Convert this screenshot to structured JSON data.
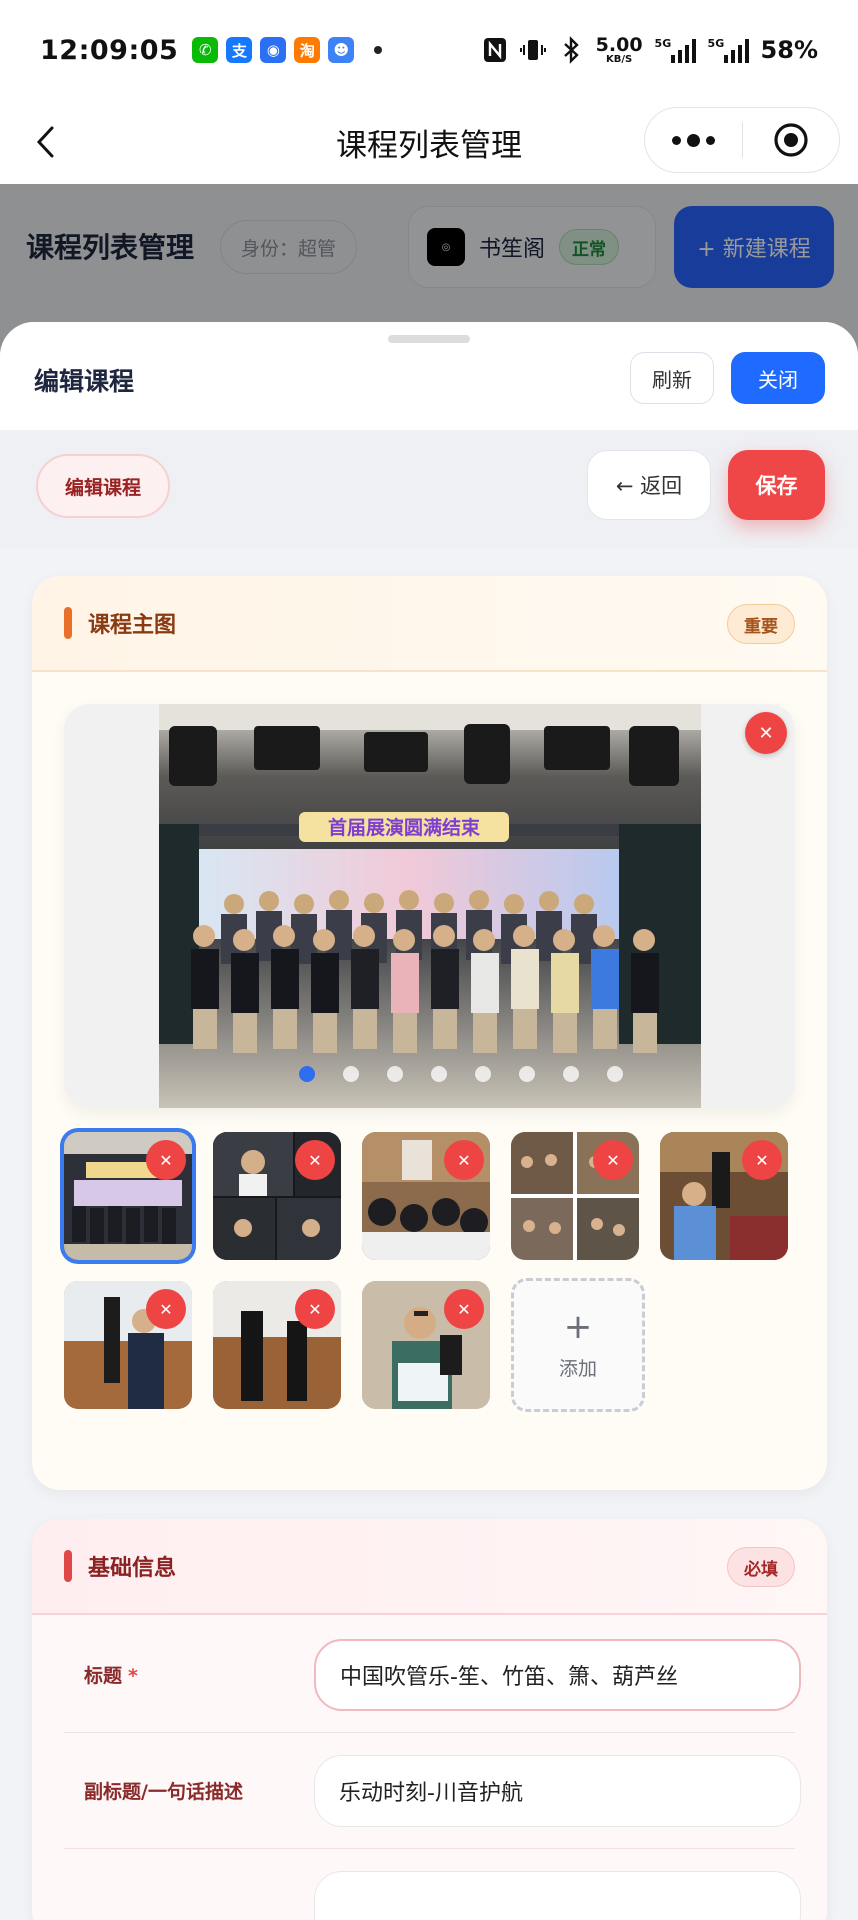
{
  "status_bar": {
    "time": "12:09:05",
    "net_speed_value": "5.00",
    "net_speed_unit": "KB/S",
    "signal_1": "5G",
    "signal_2": "5G",
    "battery": "58%",
    "app_icons": [
      {
        "name": "wechat-icon",
        "glyph": "✆",
        "color": "#09bb07"
      },
      {
        "name": "alipay-icon",
        "glyph": "支",
        "color": "#1677ff"
      },
      {
        "name": "app-icon",
        "glyph": "◉",
        "color": "#2b6ff5"
      },
      {
        "name": "taobao-icon",
        "glyph": "淘",
        "color": "#ff7a00"
      },
      {
        "name": "profile-app-icon",
        "glyph": "☻",
        "color": "#3d82f6"
      }
    ]
  },
  "nav": {
    "title": "课程列表管理"
  },
  "underlying": {
    "title": "课程列表管理",
    "role": "身份：超管",
    "shop_name": "书笙阁",
    "shop_status": "正常",
    "new_button": "+ 新建课程"
  },
  "sheet": {
    "title": "编辑课程",
    "refresh": "刷新",
    "close": "关闭"
  },
  "action_bar": {
    "edit_label": "编辑课程",
    "return_label": "← 返回",
    "save_label": "保存"
  },
  "main_image_card": {
    "title": "课程主图",
    "badge": "重要",
    "banner_text": "首届展演圆满结束",
    "pager_count": 8,
    "pager_active": 0,
    "add_label": "添加",
    "add_plus": "+",
    "thumbnails": [
      {
        "name": "thumb-group-photo",
        "scene": "stage"
      },
      {
        "name": "thumb-performance-collage",
        "scene": "dark"
      },
      {
        "name": "thumb-classroom",
        "scene": "room"
      },
      {
        "name": "thumb-collage-grid",
        "scene": "grid"
      },
      {
        "name": "thumb-player-outdoor",
        "scene": "outdoor"
      },
      {
        "name": "thumb-sheng-player",
        "scene": "wood"
      },
      {
        "name": "thumb-sheng-instruments",
        "scene": "wood2"
      },
      {
        "name": "thumb-certificate",
        "scene": "cert"
      }
    ]
  },
  "basic_info_card": {
    "title": "基础信息",
    "badge": "必填",
    "fields": [
      {
        "label": "标题",
        "required": "*",
        "value": "中国吹管乐-笙、竹笛、箫、葫芦丝"
      },
      {
        "label": "副标题/一句话描述",
        "value": "乐动时刻-川音护航"
      }
    ]
  },
  "colors": {
    "primary_blue": "#1f6bff",
    "save_red": "#ef4747",
    "delete_red": "#ef4444",
    "main_card_accent": "#e8702a",
    "basic_card_accent": "#e04848"
  }
}
